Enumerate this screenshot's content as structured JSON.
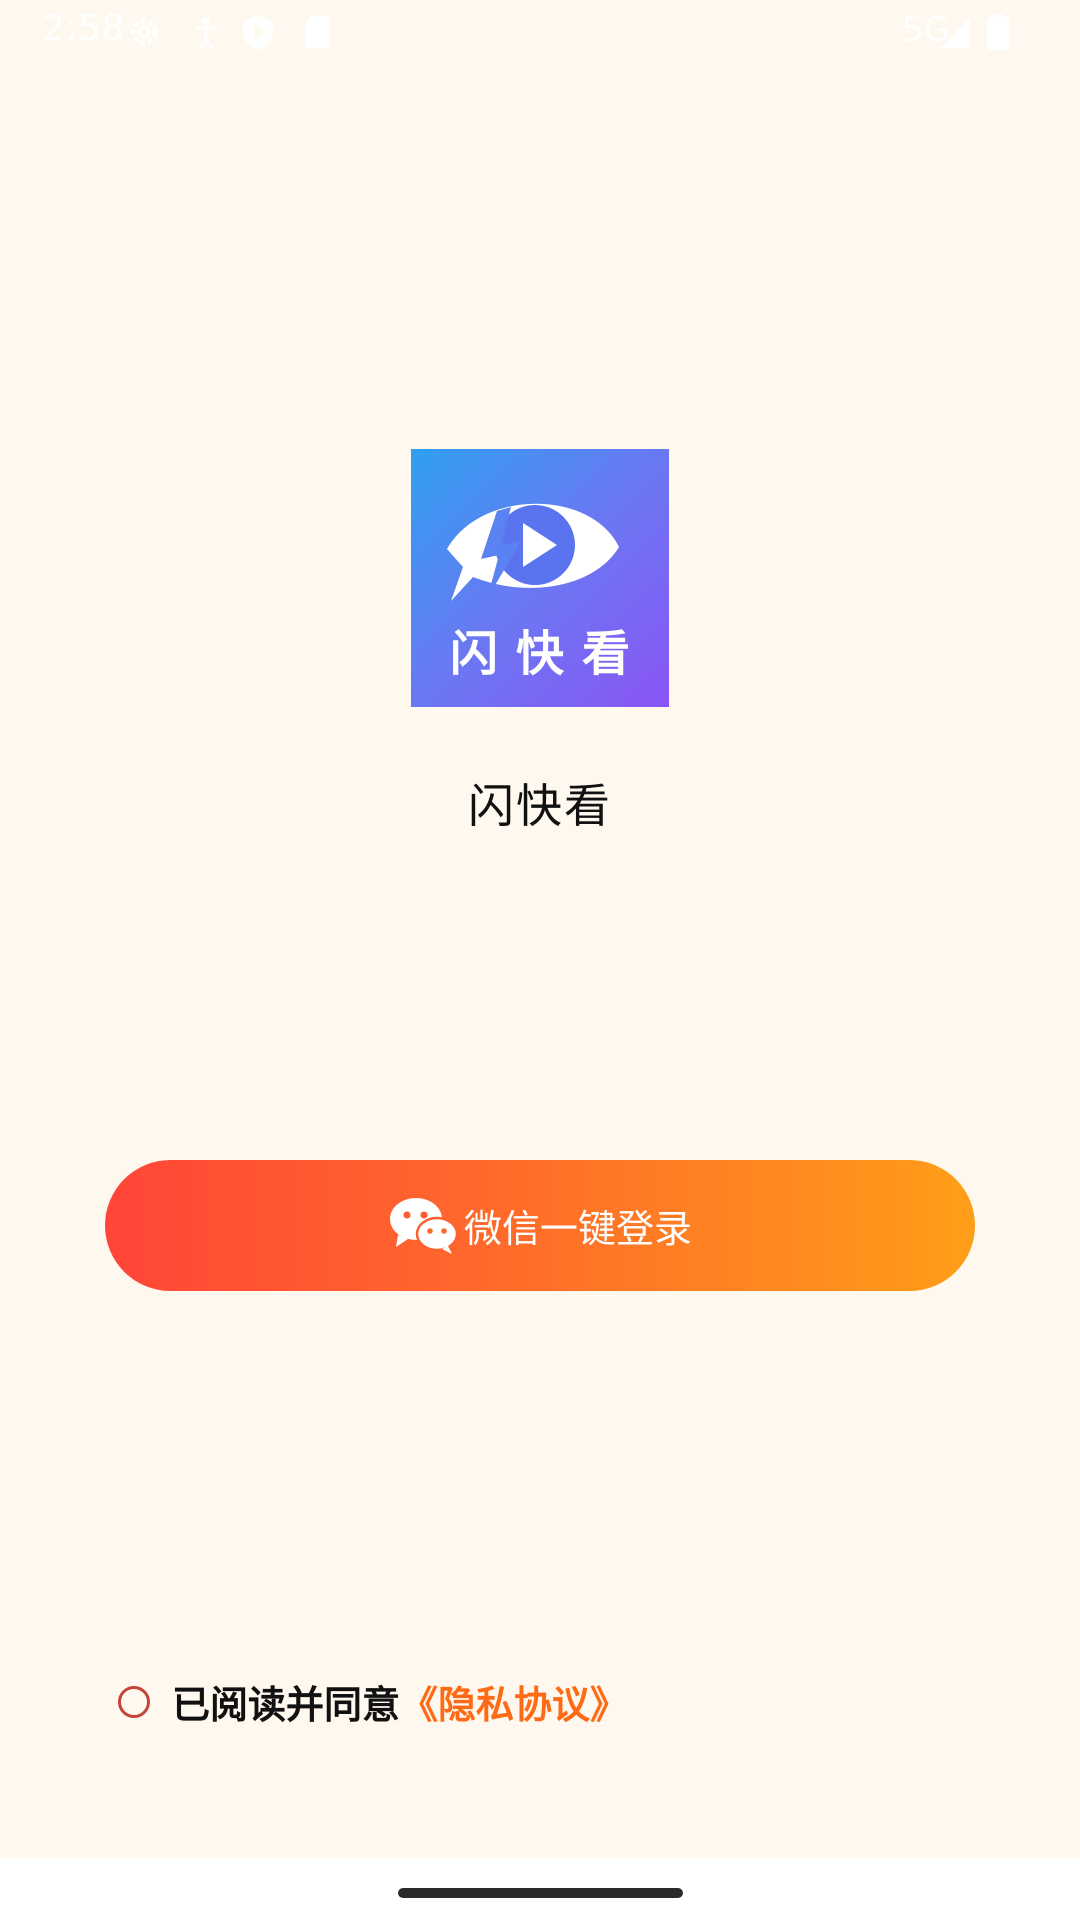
{
  "status_bar": {
    "time": "2:58",
    "network": "5G",
    "icons": [
      "settings-gear-icon",
      "accessibility-icon",
      "shield-play-icon",
      "sd-card-icon",
      "signal-icon",
      "battery-icon"
    ]
  },
  "app": {
    "logo_text": "闪快看",
    "name": "闪快看"
  },
  "login": {
    "button_label": "微信一键登录",
    "icon": "wechat-icon"
  },
  "agreement": {
    "text": "已阅读并同意",
    "link": "《隐私协议》",
    "checked": false
  },
  "colors": {
    "background": "#FFF8EF",
    "button_gradient_start": "#FF4538",
    "button_gradient_end": "#FF9E18",
    "link": "#FF6A16",
    "logo_gradient_start": "#2FA0F0",
    "logo_gradient_end": "#8A55F5"
  }
}
